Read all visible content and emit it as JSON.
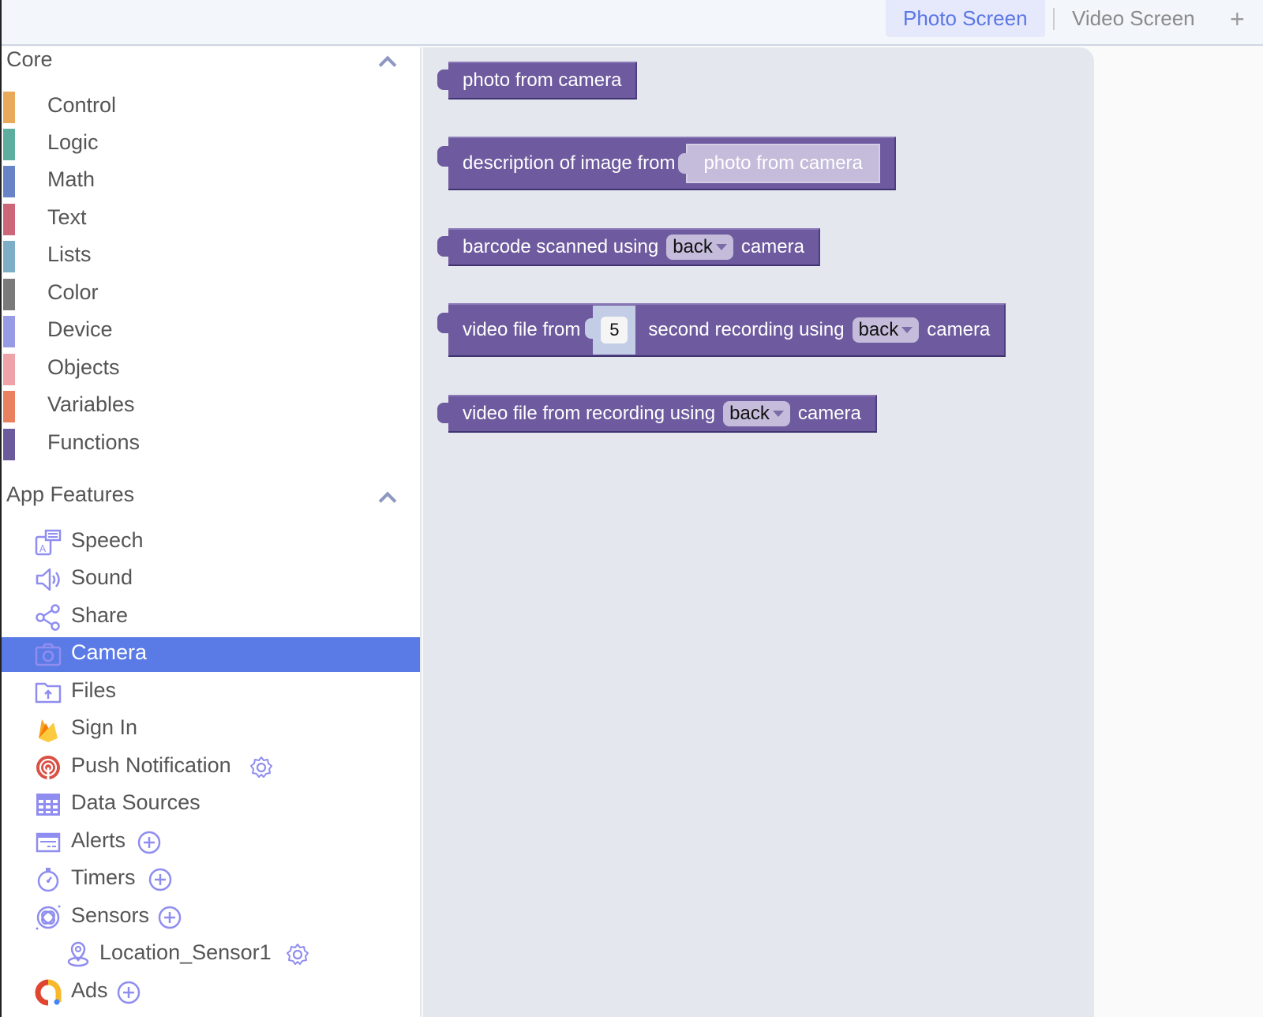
{
  "tabs": {
    "items": [
      {
        "label": "Photo Screen",
        "active": true
      },
      {
        "label": "Video Screen",
        "active": false
      }
    ],
    "add_label": "+"
  },
  "sidebar": {
    "core": {
      "title": "Core",
      "items": [
        {
          "label": "Control",
          "color": "#e8a95a"
        },
        {
          "label": "Logic",
          "color": "#5eae9f"
        },
        {
          "label": "Math",
          "color": "#6883c6"
        },
        {
          "label": "Text",
          "color": "#cc6678"
        },
        {
          "label": "Lists",
          "color": "#7eaec6"
        },
        {
          "label": "Color",
          "color": "#7a7a7a"
        },
        {
          "label": "Device",
          "color": "#979ae4"
        },
        {
          "label": "Objects",
          "color": "#eea3a8"
        },
        {
          "label": "Variables",
          "color": "#e9805f"
        },
        {
          "label": "Functions",
          "color": "#6b5b9d"
        }
      ]
    },
    "features": {
      "title": "App Features",
      "items": [
        {
          "label": "Speech",
          "icon": "speech-icon"
        },
        {
          "label": "Sound",
          "icon": "sound-icon"
        },
        {
          "label": "Share",
          "icon": "share-icon"
        },
        {
          "label": "Camera",
          "icon": "camera-icon",
          "selected": true
        },
        {
          "label": "Files",
          "icon": "files-icon"
        },
        {
          "label": "Sign In",
          "icon": "firebase-icon"
        },
        {
          "label": "Push Notification",
          "icon": "push-notification-icon",
          "trailing": "gear-icon"
        },
        {
          "label": "Data Sources",
          "icon": "table-icon"
        },
        {
          "label": "Alerts",
          "icon": "alert-icon",
          "trailing": "add-icon"
        },
        {
          "label": "Timers",
          "icon": "timer-icon",
          "trailing": "add-icon"
        },
        {
          "label": "Sensors",
          "icon": "sensor-icon",
          "trailing": "add-icon"
        },
        {
          "label": "Location_Sensor1",
          "icon": "location-icon",
          "trailing": "gear-icon",
          "child": true
        },
        {
          "label": "Ads",
          "icon": "ads-icon",
          "trailing": "add-icon"
        }
      ]
    }
  },
  "workspace": {
    "block_color": "#6e5a9e",
    "blocks": [
      {
        "parts": [
          "photo from camera"
        ]
      },
      {
        "parts": [
          "description of image from"
        ],
        "inner": "photo from camera"
      },
      {
        "parts": [
          "barcode scanned using",
          "camera"
        ],
        "dropdown": "back"
      },
      {
        "parts": [
          "video file from",
          "second recording using",
          "camera"
        ],
        "number": "5",
        "dropdown": "back"
      },
      {
        "parts": [
          "video file from recording using",
          "camera"
        ],
        "dropdown": "back"
      }
    ]
  }
}
